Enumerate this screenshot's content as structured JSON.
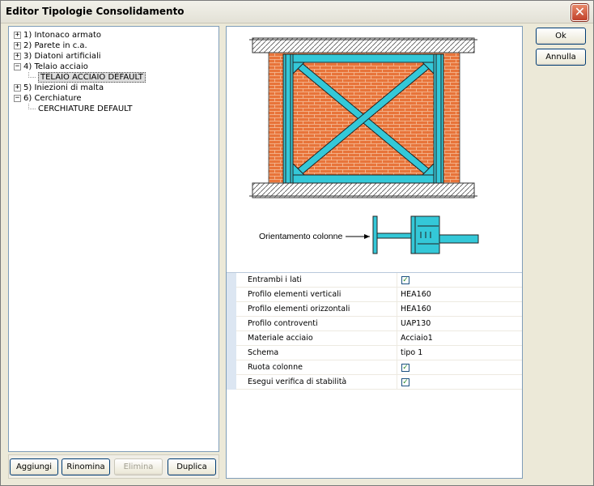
{
  "window": {
    "title": "Editor Tipologie Consolidamento",
    "close_glyph": "✕"
  },
  "tree": {
    "items": [
      {
        "label": "1) Intonaco armato",
        "expander": "+"
      },
      {
        "label": "2) Parete in c.a.",
        "expander": "+"
      },
      {
        "label": "3) Diatoni artificiali",
        "expander": "+"
      },
      {
        "label": "4) Telaio acciaio",
        "expander": "−"
      },
      {
        "label": "TELAIO ACCIAIO DEFAULT",
        "child": true
      },
      {
        "label": "5) Iniezioni di malta",
        "expander": "+"
      },
      {
        "label": "6) Cerchiature",
        "expander": "−"
      },
      {
        "label": "CERCHIATURE DEFAULT",
        "child": true
      }
    ]
  },
  "buttons": {
    "add": "Aggiungi",
    "rename": "Rinomina",
    "delete": "Elimina",
    "duplicate": "Duplica",
    "ok": "Ok",
    "cancel": "Annulla"
  },
  "drawing": {
    "orientation_label": "Orientamento colonne"
  },
  "properties": [
    {
      "name": "Entrambi i lati",
      "type": "check",
      "value": "✓"
    },
    {
      "name": "Profilo elementi verticali",
      "type": "text",
      "value": "HEA160"
    },
    {
      "name": "Profilo elementi orizzontali",
      "type": "text",
      "value": "HEA160"
    },
    {
      "name": "Profilo controventi",
      "type": "text",
      "value": "UAP130"
    },
    {
      "name": "Materiale acciaio",
      "type": "text",
      "value": "Acciaio1"
    },
    {
      "name": "Schema",
      "type": "text",
      "value": "tipo 1"
    },
    {
      "name": "Ruota colonne",
      "type": "check",
      "value": "✓"
    },
    {
      "name": "Esegui verifica di stabilità",
      "type": "check",
      "value": "✓"
    }
  ],
  "colors": {
    "brick": "#e8743a",
    "steel": "#34c8d8",
    "selection": "#dcdcdc",
    "gutter": "#dce6f2"
  }
}
